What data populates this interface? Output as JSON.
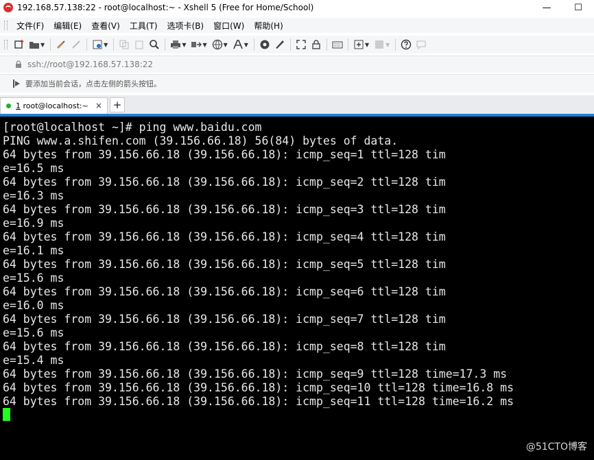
{
  "window": {
    "title": "192.168.57.138:22 - root@localhost:~ - Xshell 5 (Free for Home/School)",
    "minimize_glyph": "—",
    "maximize_glyph": "☐"
  },
  "menu": [
    "文件(F)",
    "编辑(E)",
    "查看(V)",
    "工具(T)",
    "选项卡(B)",
    "窗口(W)",
    "帮助(H)"
  ],
  "address": {
    "url": "ssh://root@192.168.57.138:22"
  },
  "hint": {
    "text": "要添加当前会话，点击左侧的箭头按钮。"
  },
  "tab": {
    "number": "1",
    "label": " root@localhost:~",
    "close_glyph": "×",
    "status_color": "#16b52b"
  },
  "add_tab_glyph": "+",
  "terminal": {
    "lines": [
      "[root@localhost ~]# ping www.baidu.com",
      "PING www.a.shifen.com (39.156.66.18) 56(84) bytes of data.",
      "64 bytes from 39.156.66.18 (39.156.66.18): icmp_seq=1 ttl=128 tim",
      "e=16.5 ms",
      "64 bytes from 39.156.66.18 (39.156.66.18): icmp_seq=2 ttl=128 tim",
      "e=16.3 ms",
      "64 bytes from 39.156.66.18 (39.156.66.18): icmp_seq=3 ttl=128 tim",
      "e=16.9 ms",
      "64 bytes from 39.156.66.18 (39.156.66.18): icmp_seq=4 ttl=128 tim",
      "e=16.1 ms",
      "64 bytes from 39.156.66.18 (39.156.66.18): icmp_seq=5 ttl=128 tim",
      "e=15.6 ms",
      "64 bytes from 39.156.66.18 (39.156.66.18): icmp_seq=6 ttl=128 tim",
      "e=16.0 ms",
      "64 bytes from 39.156.66.18 (39.156.66.18): icmp_seq=7 ttl=128 tim",
      "e=15.6 ms",
      "64 bytes from 39.156.66.18 (39.156.66.18): icmp_seq=8 ttl=128 tim",
      "e=15.4 ms",
      "64 bytes from 39.156.66.18 (39.156.66.18): icmp_seq=9 ttl=128 time=17.3 ms",
      "64 bytes from 39.156.66.18 (39.156.66.18): icmp_seq=10 ttl=128 time=16.8 ms",
      "64 bytes from 39.156.66.18 (39.156.66.18): icmp_seq=11 ttl=128 time=16.2 ms"
    ],
    "cursor_color": "#20ff20"
  },
  "watermark": "@51CTO博客",
  "colors": {
    "accent": "#1e7fd6",
    "terminal_bg": "#000000",
    "terminal_fg": "#e8e8e8"
  }
}
